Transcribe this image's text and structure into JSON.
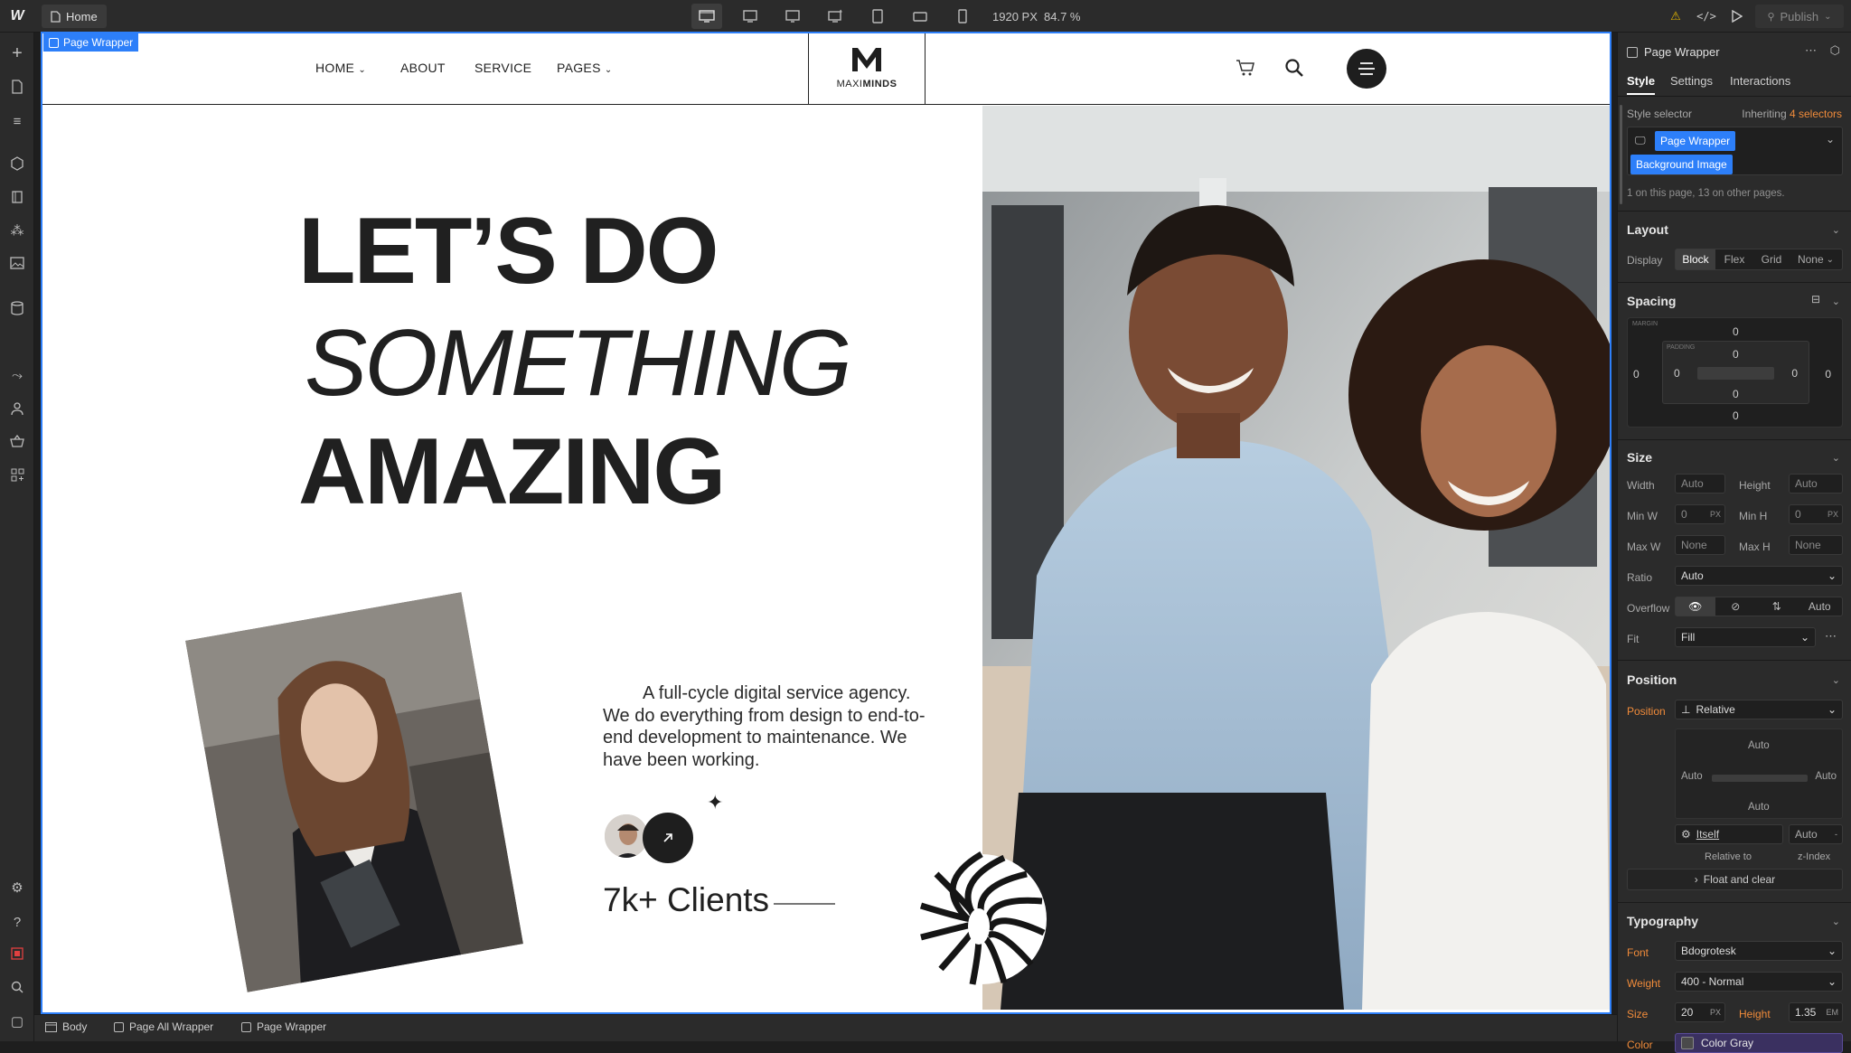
{
  "topbar": {
    "home_tab": "Home",
    "width_readout": "1920 PX",
    "zoom_readout": "84.7 %",
    "publish_label": "Publish"
  },
  "canvas": {
    "selection_label": "Page Wrapper",
    "nav": {
      "items": [
        "HOME",
        "ABOUT",
        "SERVICE",
        "PAGES"
      ],
      "logo_text_left": "MAXI",
      "logo_text_right": "MINDS"
    },
    "hero": {
      "line1": "LET’S DO",
      "line2": "SOMETHING",
      "line3": "AMAZING",
      "description": "A full-cycle digital service agency. We do everything from design to end-to-end development to maintenance. We have been working.",
      "clients": "7k+ Clients"
    }
  },
  "right_panel": {
    "element_name": "Page Wrapper",
    "tabs": [
      "Style",
      "Settings",
      "Interactions"
    ],
    "style_selector_label": "Style selector",
    "inheriting_label": "Inheriting",
    "inheriting_count": "4 selectors",
    "selector_chip_1": "Page Wrapper",
    "selector_chip_2": "Background Image",
    "selector_usage": "1 on this page, 13 on other pages.",
    "layout": {
      "title": "Layout",
      "display_label": "Display",
      "options": [
        "Block",
        "Flex",
        "Grid",
        "None"
      ]
    },
    "spacing": {
      "title": "Spacing",
      "margin_label": "MARGIN",
      "padding_label": "PADDING",
      "margin_top": "0",
      "margin_bottom": "0",
      "margin_left": "0",
      "margin_right": "0",
      "padding_top": "0",
      "padding_bottom": "0",
      "padding_left": "0",
      "padding_right": "0"
    },
    "size": {
      "title": "Size",
      "width_label": "Width",
      "width_value": "Auto",
      "height_label": "Height",
      "height_value": "Auto",
      "minw_label": "Min W",
      "minw_value": "0",
      "minw_unit": "PX",
      "minh_label": "Min H",
      "minh_value": "0",
      "minh_unit": "PX",
      "maxw_label": "Max W",
      "maxw_value": "None",
      "maxh_label": "Max H",
      "maxh_value": "None",
      "ratio_label": "Ratio",
      "ratio_value": "Auto",
      "overflow_label": "Overflow",
      "overflow_auto": "Auto",
      "fit_label": "Fit",
      "fit_value": "Fill"
    },
    "position": {
      "title": "Position",
      "position_label": "Position",
      "position_value": "Relative",
      "top": "Auto",
      "left": "Auto",
      "right": "Auto",
      "bottom": "Auto",
      "relative_value": "Itself",
      "zindex_value": "Auto",
      "relative_label": "Relative to",
      "zindex_label": "z-Index",
      "float_label": "Float and clear"
    },
    "typography": {
      "title": "Typography",
      "font_label": "Font",
      "font_value": "Bdogrotesk",
      "weight_label": "Weight",
      "weight_value": "400 - Normal",
      "size_label": "Size",
      "size_value": "20",
      "size_unit": "PX",
      "height_label": "Height",
      "height_value": "1.35",
      "height_unit": "EM",
      "color_label": "Color",
      "color_value": "Color Gray"
    }
  },
  "breadcrumb": [
    "Body",
    "Page All Wrapper",
    "Page Wrapper"
  ],
  "colors": {
    "accent": "#2d7ff9",
    "panel_bg": "#2b2b2b",
    "highlight_orange": "#f08b3a",
    "color_gray_swatch": "#4a4a4a"
  }
}
